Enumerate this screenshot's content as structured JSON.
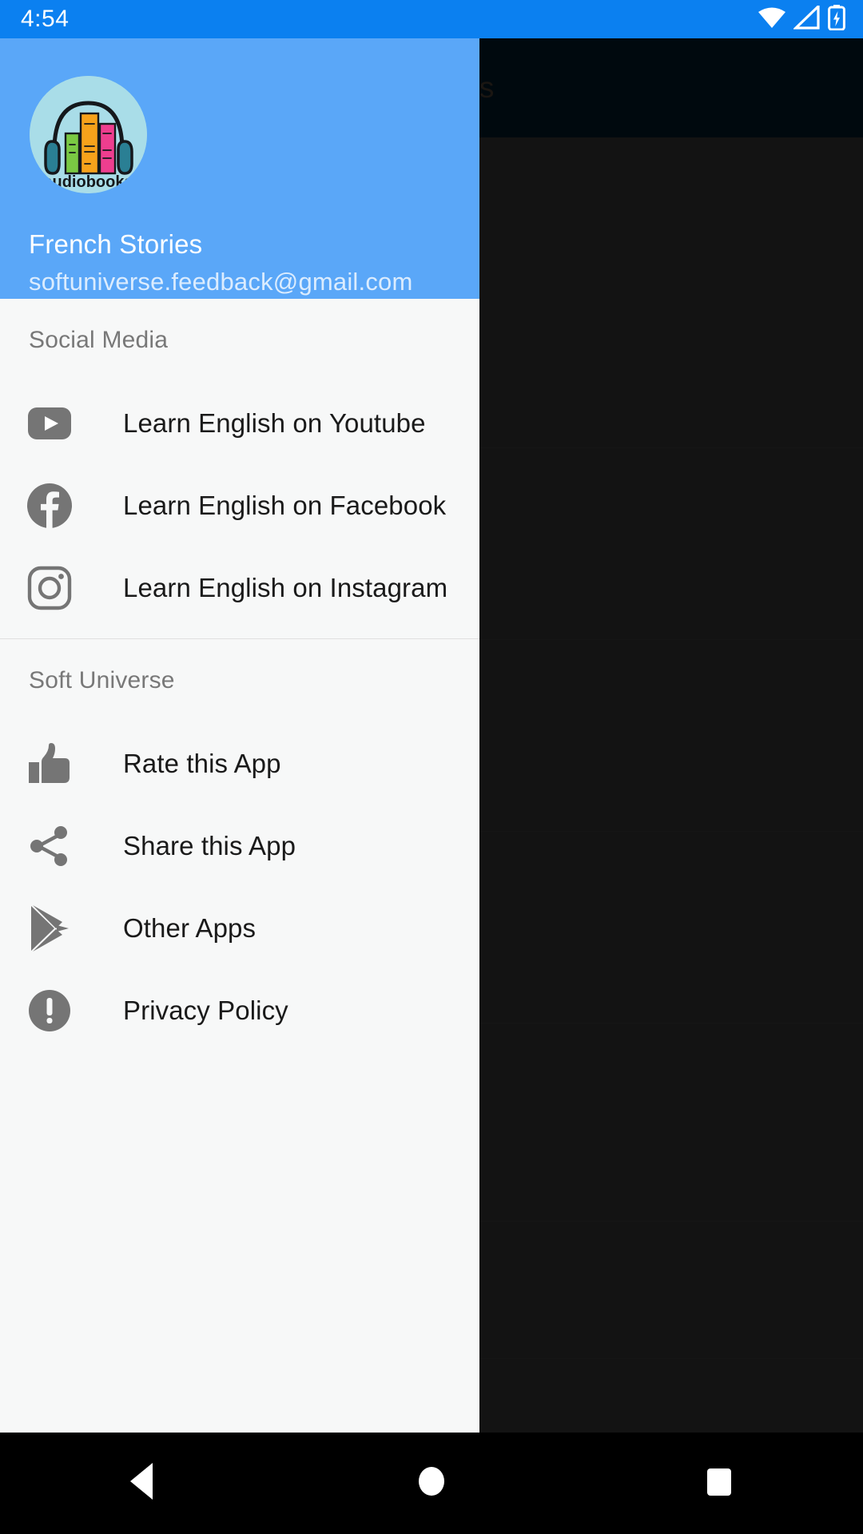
{
  "status_bar": {
    "time": "4:54",
    "background_color": "#0b80f0",
    "icons": [
      "wifi-icon",
      "cellular-signal-icon",
      "battery-charging-icon"
    ]
  },
  "background_app": {
    "app_bar_title": "nners",
    "app_bar_color": "#021420",
    "content_color": "#2b2b2b"
  },
  "drawer": {
    "background_color": "#f7f8f8",
    "header": {
      "background_color": "#5aa7f8",
      "avatar_label": "audiobooks",
      "account_name": "French Stories",
      "account_email": "softuniverse.feedback@gmail.com"
    },
    "sections": [
      {
        "title": "Social Media",
        "items": [
          {
            "icon": "youtube-icon",
            "label": "Learn English on Youtube"
          },
          {
            "icon": "facebook-icon",
            "label": "Learn English on Facebook"
          },
          {
            "icon": "instagram-icon",
            "label": "Learn English on Instagram"
          }
        ]
      },
      {
        "title": "Soft Universe",
        "items": [
          {
            "icon": "thumbs-up-icon",
            "label": "Rate this App"
          },
          {
            "icon": "share-icon",
            "label": "Share this App"
          },
          {
            "icon": "google-play-icon",
            "label": "Other Apps"
          },
          {
            "icon": "exclamation-icon",
            "label": "Privacy Policy"
          }
        ]
      }
    ]
  },
  "nav_bar": {
    "background_color": "#000000",
    "buttons": [
      {
        "icon": "back-icon",
        "label": "Back"
      },
      {
        "icon": "home-icon",
        "label": "Home"
      },
      {
        "icon": "recents-icon",
        "label": "Recents"
      }
    ]
  }
}
